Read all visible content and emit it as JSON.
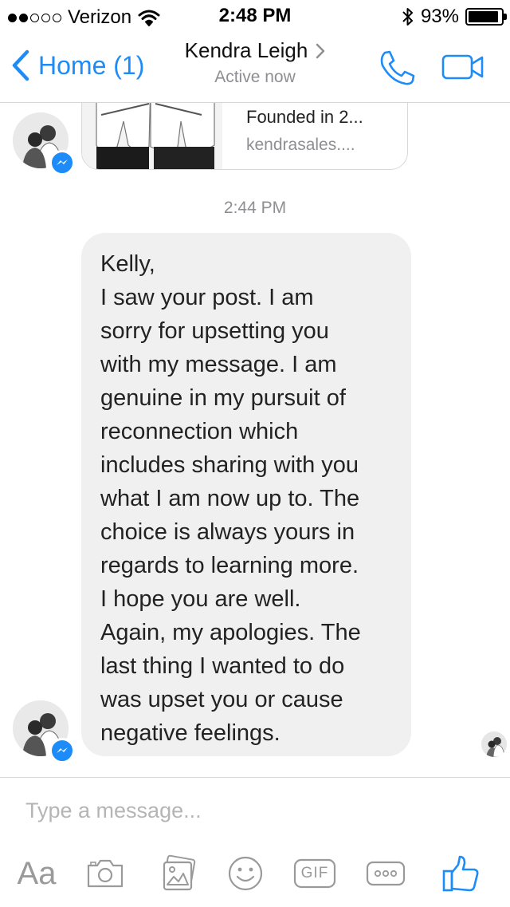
{
  "status_bar": {
    "carrier": "Verizon",
    "time": "2:48 PM",
    "battery": "93%",
    "battery_level": 0.93,
    "signal_bars": 2,
    "signal_total": 5
  },
  "nav": {
    "back_label": "Home (1)",
    "contact_name": "Kendra Leigh",
    "contact_status": "Active now"
  },
  "link_preview": {
    "title": "Founded in 2...",
    "domain": "kendrasales...."
  },
  "timestamp": "2:44 PM",
  "message": {
    "text": "Kelly,\nI saw your post. I am\nsorry for upsetting you\nwith my message. I am\ngenuine in my pursuit of\nreconnection which\nincludes sharing with you\nwhat I am now up to. The\nchoice is always yours in\nregards to learning more.\nI hope you are well.\nAgain, my apologies. The\nlast thing I wanted to do\nwas upset you or cause\nnegative feelings."
  },
  "composer": {
    "placeholder": "Type a message...",
    "text_tool_label": "Aa",
    "gif_label": "GIF"
  },
  "colors": {
    "accent": "#1d8cf8",
    "bubble": "#f1f0f0",
    "muted": "#8e8e93"
  }
}
